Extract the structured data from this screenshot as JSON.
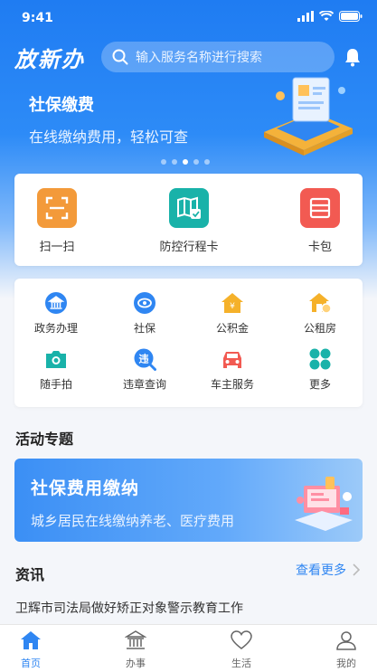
{
  "status": {
    "time": "9:41"
  },
  "header": {
    "logo": "放新办",
    "search_placeholder": "输入服务名称进行搜索"
  },
  "banner": {
    "title": "社保缴费",
    "subtitle": "在线缴纳费用，轻松可查",
    "dots_total": 5,
    "dots_active": 3
  },
  "quick_tools": [
    {
      "label": "扫一扫",
      "icon": "scan-icon",
      "color": "#f39a3a"
    },
    {
      "label": "防控行程卡",
      "icon": "map-pass-icon",
      "color": "#19b2a9"
    },
    {
      "label": "卡包",
      "icon": "card-wallet-icon",
      "color": "#f25a52"
    }
  ],
  "services": [
    {
      "label": "政务办理",
      "icon": "government-icon",
      "color": "#2f86f2"
    },
    {
      "label": "社保",
      "icon": "social-security-icon",
      "color": "#2f86f2"
    },
    {
      "label": "公积金",
      "icon": "housing-fund-icon",
      "color": "#f5b12a"
    },
    {
      "label": "公租房",
      "icon": "public-housing-icon",
      "color": "#f5b12a"
    },
    {
      "label": "随手拍",
      "icon": "camera-icon",
      "color": "#19b2a9"
    },
    {
      "label": "违章查询",
      "icon": "violation-search-icon",
      "color": "#2f86f2"
    },
    {
      "label": "车主服务",
      "icon": "car-icon",
      "color": "#f25a52"
    },
    {
      "label": "更多",
      "icon": "more-grid-icon",
      "color": "#19b2a9"
    }
  ],
  "activity": {
    "section_title": "活动专题",
    "promo_title": "社保费用缴纳",
    "promo_subtitle": "城乡居民在线缴纳养老、医疗费用"
  },
  "news": {
    "section_title": "资讯",
    "more_label": "查看更多",
    "items": [
      "卫辉市司法局做好矫正对象警示教育工作"
    ]
  },
  "tabs": [
    {
      "label": "首页",
      "icon": "home-icon",
      "active": true
    },
    {
      "label": "办事",
      "icon": "building-icon",
      "active": false
    },
    {
      "label": "生活",
      "icon": "heart-icon",
      "active": false
    },
    {
      "label": "我的",
      "icon": "user-icon",
      "active": false
    }
  ]
}
